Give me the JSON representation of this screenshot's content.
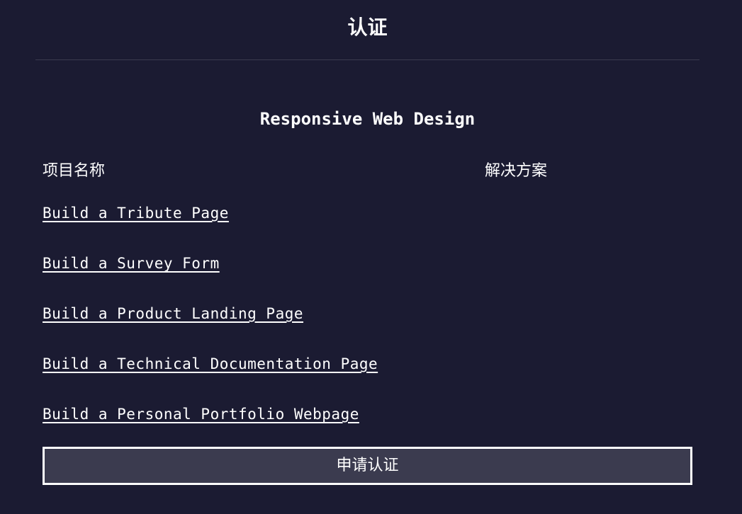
{
  "header": {
    "title": "认证"
  },
  "certification": {
    "name": "Responsive Web Design",
    "columns": {
      "project": "项目名称",
      "solution": "解决方案"
    },
    "projects": [
      {
        "label": "Build a Tribute Page"
      },
      {
        "label": "Build a Survey Form"
      },
      {
        "label": "Build a Product Landing Page"
      },
      {
        "label": "Build a Technical Documentation Page"
      },
      {
        "label": "Build a Personal Portfolio Webpage"
      }
    ],
    "claim_button_label": "申请认证"
  },
  "colors": {
    "background": "#1b1b32",
    "button_background": "#3b3b4f",
    "text": "#ffffff",
    "divider": "#3b3b4f"
  }
}
